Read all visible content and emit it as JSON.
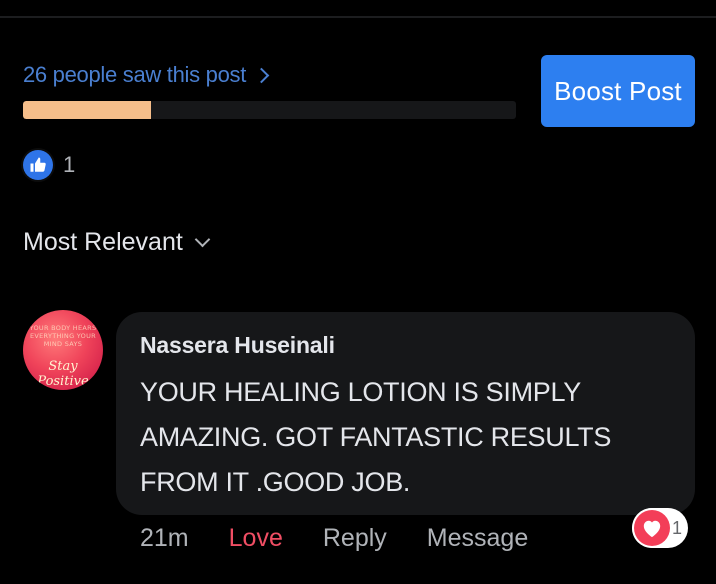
{
  "post_stats": {
    "reach_text": "26 people saw this post",
    "reach_progress_fraction": 0.26,
    "boost_label": "Boost Post"
  },
  "reactions": {
    "icon": "thumbs-up-icon",
    "count": "1"
  },
  "sort": {
    "label": "Most Relevant"
  },
  "comment": {
    "avatar_text_lines": [
      "YOUR BODY HEARS",
      "EVERYTHING YOUR",
      "MIND SAYS"
    ],
    "avatar_script": "Stay Positive",
    "author": "Nassera Huseinali",
    "text": "YOUR HEALING LOTION IS SIMPLY AMAZING. GOT FANTASTIC RESULTS FROM IT .GOOD JOB.",
    "time": "21m",
    "actions": {
      "love": "Love",
      "reply": "Reply",
      "message": "Message"
    },
    "reaction": {
      "icon": "heart-icon",
      "count": "1"
    }
  },
  "colors": {
    "background": "#000000",
    "link": "#4a7fd0",
    "boost_button": "#2d7ff0",
    "progress_fill": "#f6be8a",
    "love": "#f04e64",
    "bubble": "#161719"
  }
}
